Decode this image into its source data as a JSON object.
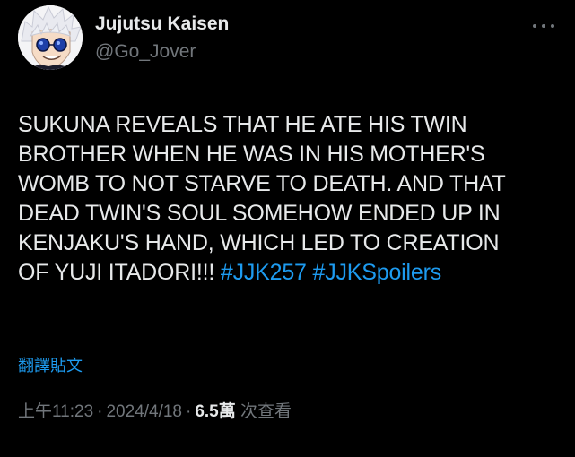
{
  "header": {
    "display_name": "Jujutsu Kaisen",
    "handle": "@Go_Jover",
    "more_icon": "more-horizontal-icon"
  },
  "tweet": {
    "lines": [
      "SUKUNA REVEALS THAT HE ATE HIS TWIN",
      "BROTHER WHEN HE WAS IN HIS MOTHER'S",
      "WOMB TO NOT STARVE TO DEATH. AND THAT",
      "DEAD TWIN'S SOUL SOMEHOW ENDED UP IN",
      "KENJAKU'S HAND, WHICH LED TO CREATION"
    ],
    "last_line_text": "OF YUJI ITADORI!!! ",
    "hashtags": [
      "#JJK257",
      "#JJKSpoilers"
    ]
  },
  "translate_label": "翻譯貼文",
  "meta": {
    "time": "上午11:23",
    "date": "2024/4/18",
    "views_count": "6.5萬",
    "views_label": "次查看",
    "separator": "·"
  },
  "colors": {
    "background": "#000000",
    "text": "#e7e9ea",
    "muted": "#71767b",
    "link": "#1d9bf0"
  }
}
